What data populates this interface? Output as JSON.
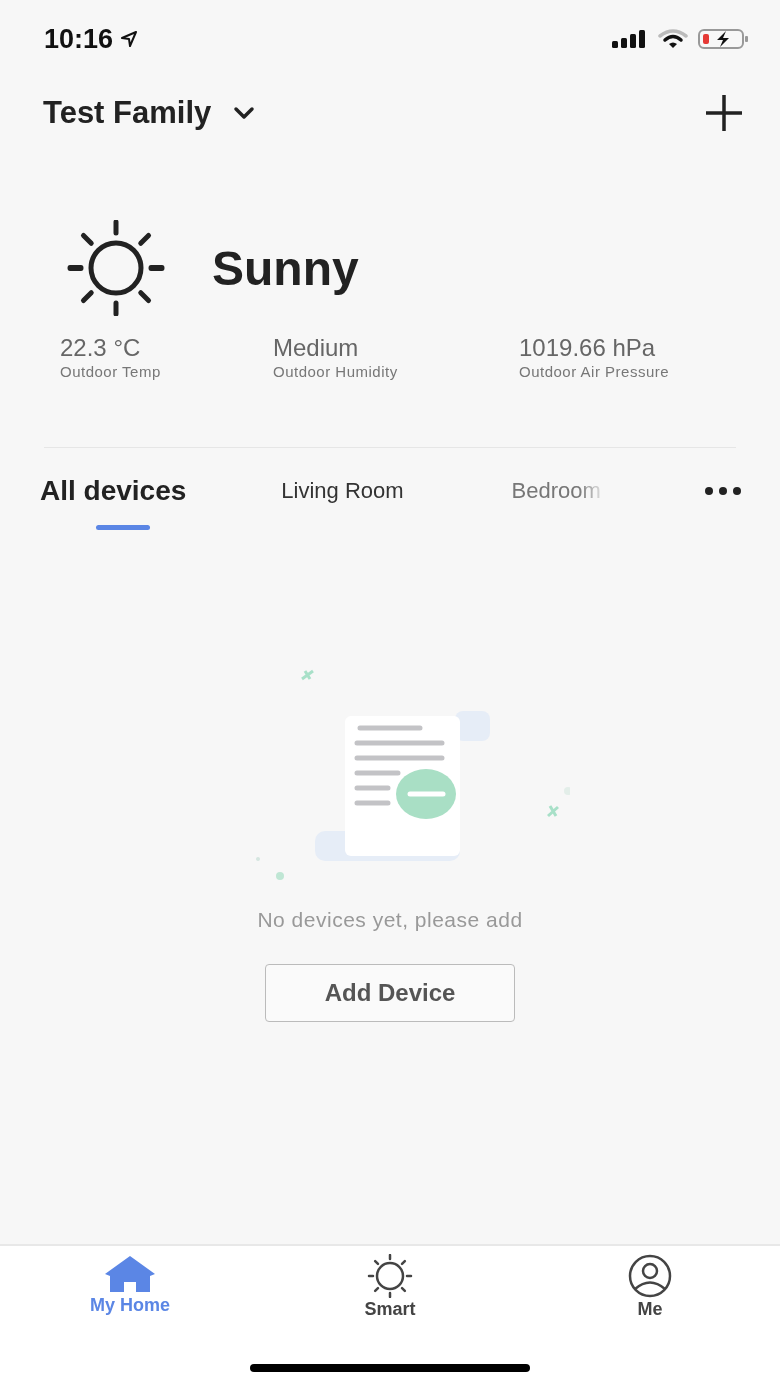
{
  "status_bar": {
    "time": "10:16"
  },
  "header": {
    "title": "Test Family"
  },
  "weather": {
    "condition": "Sunny",
    "stats": [
      {
        "value": "22.3 °C",
        "label": "Outdoor Temp"
      },
      {
        "value": "Medium",
        "label": "Outdoor Humidity"
      },
      {
        "value": "1019.66 hPa",
        "label": "Outdoor Air Pressure"
      }
    ]
  },
  "tabs": [
    {
      "label": "All devices",
      "selected": true
    },
    {
      "label": "Living Room",
      "selected": false
    },
    {
      "label": "Bedroom",
      "selected": false
    }
  ],
  "empty_state": {
    "message": "No devices yet, please add",
    "button": "Add Device"
  },
  "bottom_nav": [
    {
      "label": "My Home",
      "kind": "home",
      "selected": true
    },
    {
      "label": "Smart",
      "kind": "smart",
      "selected": false
    },
    {
      "label": "Me",
      "kind": "me",
      "selected": false
    }
  ]
}
